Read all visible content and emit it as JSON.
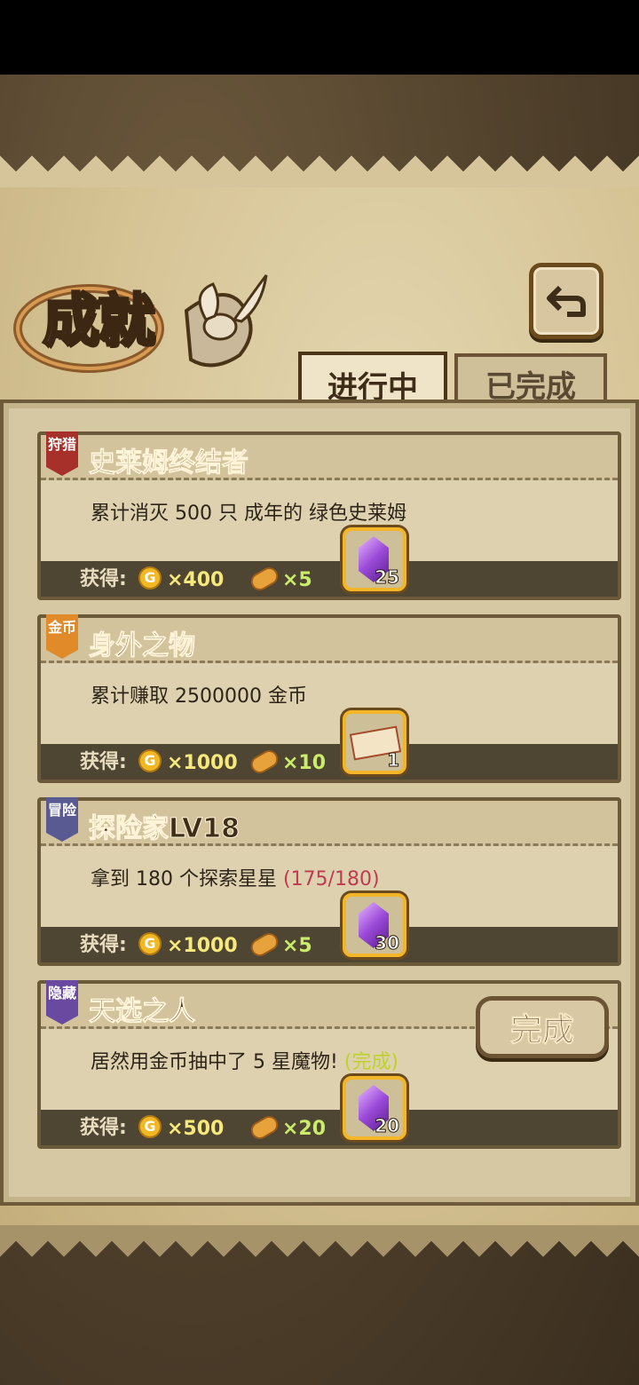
{
  "title": "成就",
  "tabs": [
    {
      "label": "进行中",
      "active": true
    },
    {
      "label": "已完成",
      "active": false
    }
  ],
  "reward_label": "获得:",
  "coin_glyph": "G",
  "achievements": [
    {
      "badge": "狩猎",
      "badge_color": "#a8302a",
      "name": "史莱姆终结者",
      "desc": "累计消灭 500 只 成年的 绿色史莱姆",
      "progress": "",
      "coins": "×400",
      "bread": "×5",
      "reward_item": "gem",
      "reward_qty": "25"
    },
    {
      "badge": "金币",
      "badge_color": "#e08a2a",
      "name": "身外之物",
      "desc": "累计赚取 2500000 金币",
      "progress": "",
      "coins": "×1000",
      "bread": "×10",
      "reward_item": "ticket",
      "reward_qty": "1"
    },
    {
      "badge": "冒险",
      "badge_color": "#5a5a92",
      "name": "探险家LV18",
      "desc": "拿到 180 个探索星星",
      "progress": "(175/180)",
      "coins": "×1000",
      "bread": "×5",
      "reward_item": "gem",
      "reward_qty": "30"
    },
    {
      "badge": "隐藏",
      "badge_color": "#6a4aa0",
      "name": "天选之人",
      "desc": "居然用金币抽中了 5 星魔物!",
      "status": "(完成)",
      "coins": "×500",
      "bread": "×20",
      "reward_item": "gem",
      "reward_qty": "20",
      "complete_button": "完成"
    }
  ]
}
